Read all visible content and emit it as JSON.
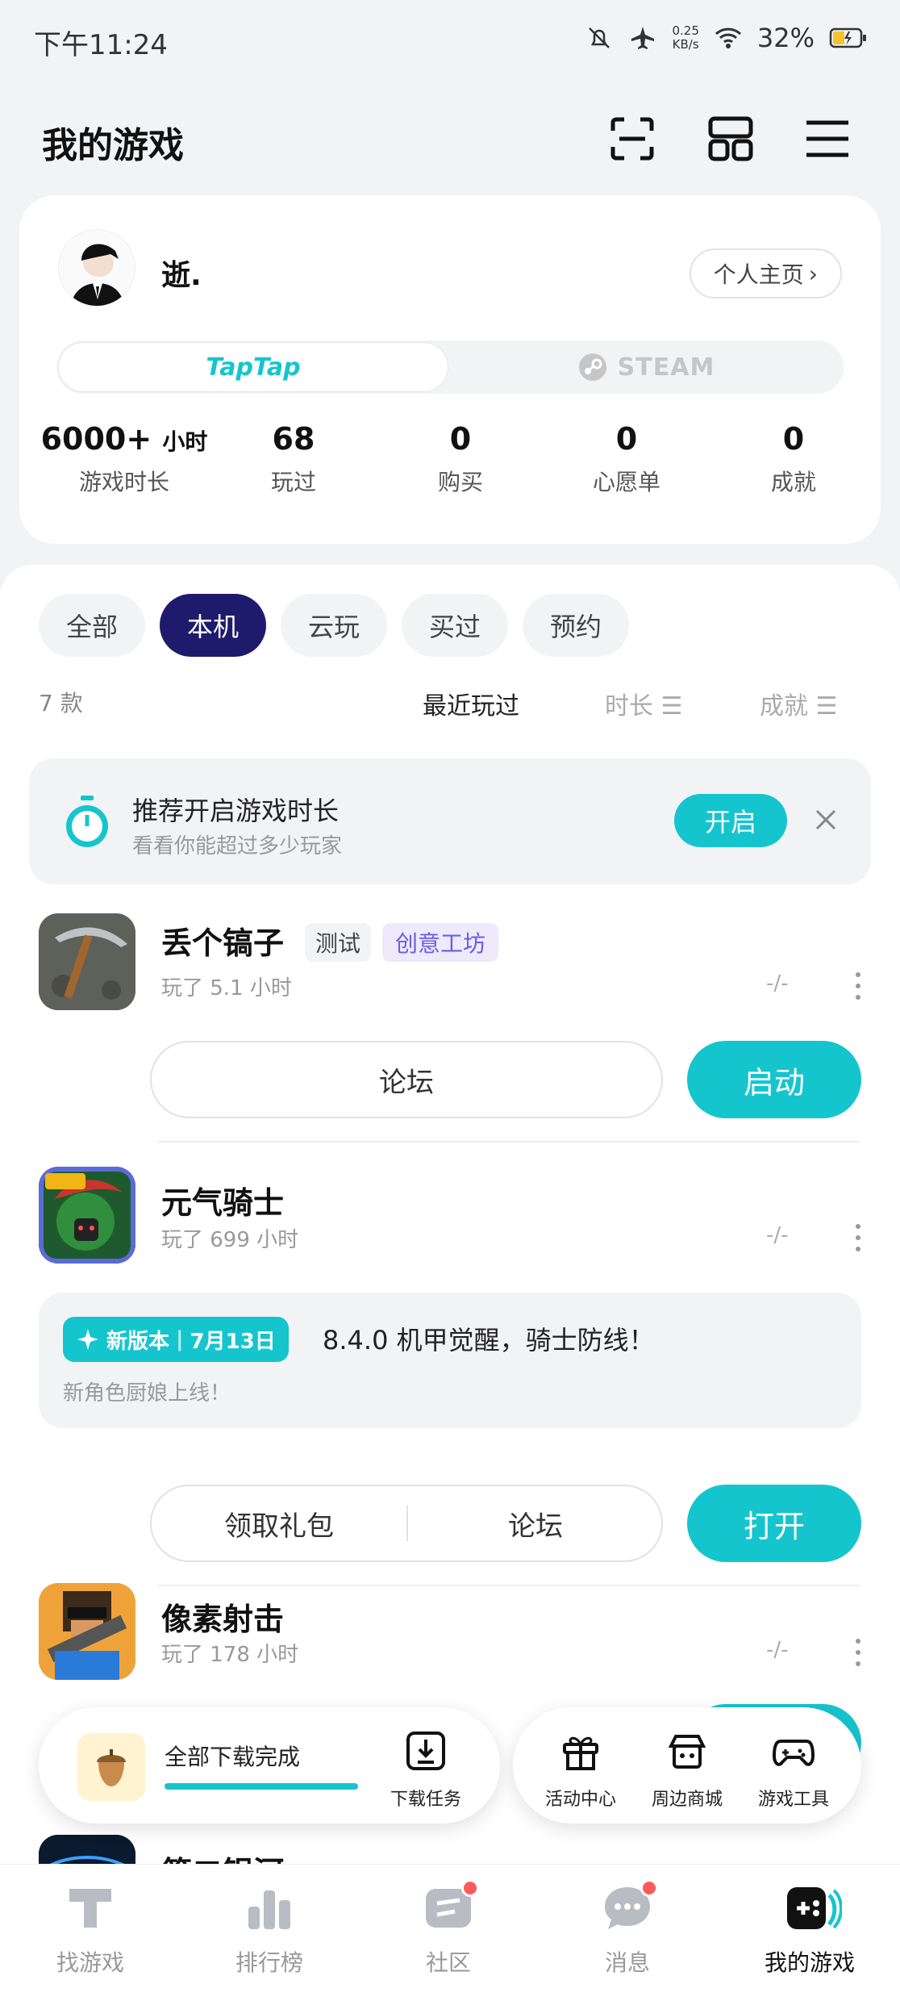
{
  "status_bar": {
    "time": "下午11:24",
    "speed_value": "0.25",
    "speed_unit": "KB/s",
    "battery": "32%"
  },
  "header": {
    "title": "我的游戏"
  },
  "profile": {
    "username": "逝.",
    "homepage_label": "个人主页",
    "platforms": {
      "taptap": "TapTap",
      "steam": "STEAM"
    },
    "stats": [
      {
        "value": "6000+",
        "unit": "小时",
        "label": "游戏时长"
      },
      {
        "value": "68",
        "unit": "",
        "label": "玩过"
      },
      {
        "value": "0",
        "unit": "",
        "label": "购买"
      },
      {
        "value": "0",
        "unit": "",
        "label": "心愿单"
      },
      {
        "value": "0",
        "unit": "",
        "label": "成就"
      }
    ]
  },
  "filters": {
    "chips": [
      "全部",
      "本机",
      "云玩",
      "买过",
      "预约"
    ],
    "active": "本机",
    "count": "7 款",
    "sort": [
      "最近玩过",
      "时长",
      "成就"
    ]
  },
  "banner": {
    "title": "推荐开启游戏时长",
    "subtitle": "看看你能超过多少玩家",
    "button": "开启"
  },
  "games": [
    {
      "name": "丢个镐子",
      "tags": [
        "测试",
        "创意工坊"
      ],
      "played": "玩了 5.1 小时",
      "dash": "-/-",
      "actions": [
        "论坛"
      ],
      "primary": "启动"
    },
    {
      "name": "元气骑士",
      "tags": [],
      "played": "玩了 699 小时",
      "dash": "-/-",
      "news": {
        "badge_label": "新版本",
        "badge_date": "7月13日",
        "headline": "8.4.0 机甲觉醒，骑士防线！",
        "sub": "新角色厨娘上线！"
      },
      "actions": [
        "领取礼包",
        "论坛"
      ],
      "primary": "打开"
    },
    {
      "name": "像素射击",
      "tags": [],
      "played": "玩了 178 小时",
      "dash": "-/-"
    },
    {
      "name": "第二银河"
    }
  ],
  "floating": {
    "download_text": "全部下载完成",
    "download_progress": 1.0,
    "download_tasks": "下载任务",
    "activity_center": "活动中心",
    "merch": "周边商城",
    "game_tools": "游戏工具"
  },
  "bottom_nav": [
    {
      "label": "找游戏",
      "badge": false
    },
    {
      "label": "排行榜",
      "badge": false
    },
    {
      "label": "社区",
      "badge": true
    },
    {
      "label": "消息",
      "badge": true
    },
    {
      "label": "我的游戏",
      "badge": false,
      "active": true
    }
  ],
  "colors": {
    "accent": "#15c5ce",
    "chip_active": "#1e1b6d",
    "creative_tag": "#6b5ce7"
  }
}
